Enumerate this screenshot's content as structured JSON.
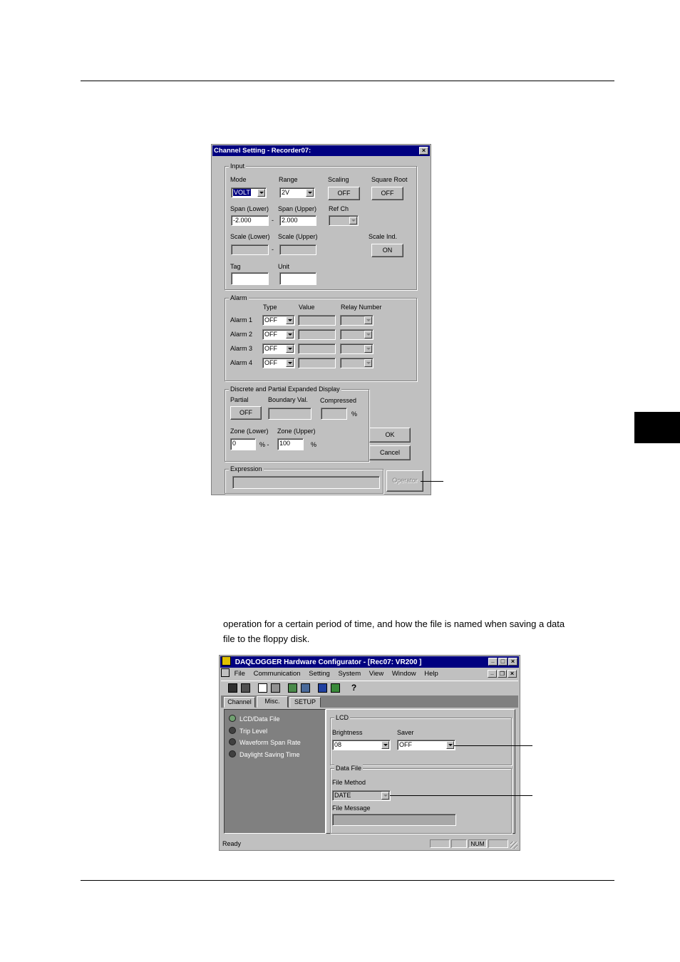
{
  "page": {
    "paragraph_line1": "operation for a certain period of time, and how the file is named when saving a data",
    "paragraph_line2": "file to the floppy disk."
  },
  "dialog": {
    "title": "Channel Setting - Recorder07:",
    "close_glyph": "×",
    "input_group": {
      "title": "Input",
      "mode_label": "Mode",
      "mode_value": "VOLT",
      "range_label": "Range",
      "range_value": "2V",
      "scaling_label": "Scaling",
      "scaling_button": "OFF",
      "sqrt_label": "Square Root",
      "sqrt_button": "OFF",
      "span_lower_label": "Span (Lower)",
      "span_lower_value": "-2.000",
      "span_upper_label": "Span (Upper)",
      "span_upper_value": "2.000",
      "dash": "-",
      "refch_label": "Ref Ch",
      "scale_lower_label": "Scale (Lower)",
      "scale_upper_label": "Scale (Upper)",
      "scale_ind_label": "Scale Ind.",
      "scale_ind_button": "ON",
      "tag_label": "Tag",
      "unit_label": "Unit"
    },
    "alarm_group": {
      "title": "Alarm",
      "type_header": "Type",
      "value_header": "Value",
      "relay_header": "Relay Number",
      "rows": [
        {
          "label": "Alarm 1",
          "type": "OFF"
        },
        {
          "label": "Alarm 2",
          "type": "OFF"
        },
        {
          "label": "Alarm 3",
          "type": "OFF"
        },
        {
          "label": "Alarm 4",
          "type": "OFF"
        }
      ]
    },
    "discrete_group": {
      "title": "Discrete and Partial Expanded Display",
      "partial_label": "Partial",
      "partial_button": "OFF",
      "boundary_label": "Boundary Val.",
      "compressed_label": "Compressed",
      "percent": "%",
      "zone_lower_label": "Zone (Lower)",
      "zone_lower_value": "0",
      "zone_lower_unit": "% -",
      "zone_upper_label": "Zone (Upper)",
      "zone_upper_value": "100",
      "zone_upper_unit": "%"
    },
    "ok_button": "OK",
    "cancel_button": "Cancel",
    "expression_group": {
      "title": "Expression"
    },
    "operator_button": "Operator"
  },
  "app": {
    "title": "DAQLOGGER Hardware Configurator - [Rec07: VR200   ]",
    "menu": [
      "File",
      "Communication",
      "Setting",
      "System",
      "View",
      "Window",
      "Help"
    ],
    "tabs": [
      "Channel",
      "Misc.",
      "SETUP"
    ],
    "tree_items": [
      "LCD/Data File",
      "Trip Level",
      "Waveform Span Rate",
      "Daylight Saving Time"
    ],
    "lcd_group": {
      "title": "LCD",
      "brightness_label": "Brightness",
      "brightness_value": "08",
      "saver_label": "Saver",
      "saver_value": "OFF"
    },
    "datafile_group": {
      "title": "Data File",
      "file_method_label": "File Method",
      "file_method_value": "DATE",
      "file_message_label": "File Message"
    },
    "status": {
      "text": "Ready",
      "num": "NUM"
    }
  },
  "colors": {
    "titlebar": "#000080",
    "face": "#c0c0c0",
    "tree_bg": "#808080"
  }
}
